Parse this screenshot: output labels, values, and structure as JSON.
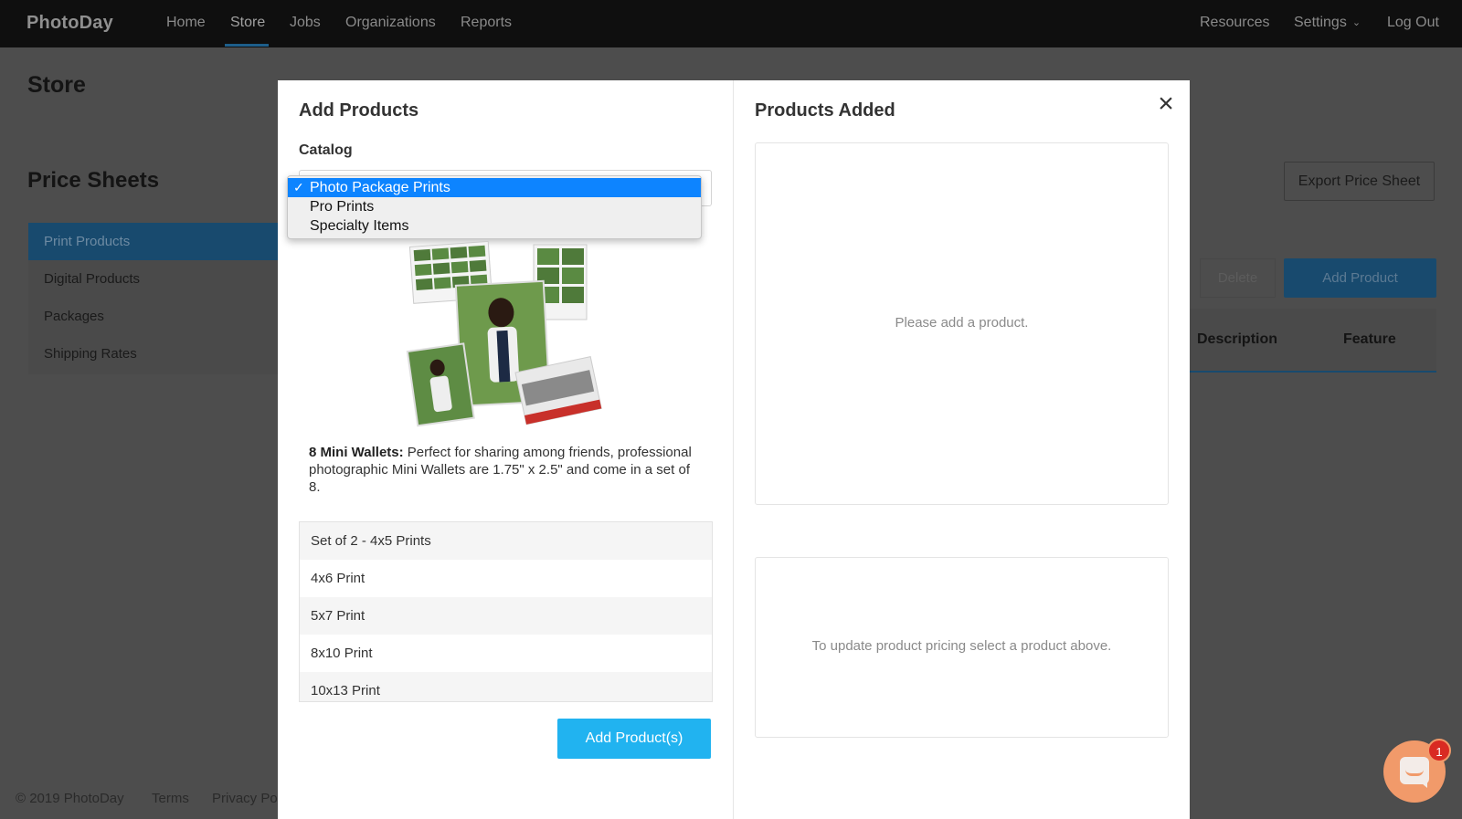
{
  "brand": {
    "logo_text": "PhotoDay"
  },
  "nav": {
    "left": [
      "Home",
      "Store",
      "Jobs",
      "Organizations",
      "Reports"
    ],
    "active": "Store",
    "right": {
      "resources": "Resources",
      "settings": "Settings",
      "logout": "Log Out"
    }
  },
  "page": {
    "title": "Store",
    "section_title": "Price Sheets",
    "sidebar": [
      "Print Products",
      "Digital Products",
      "Packages",
      "Shipping Rates"
    ],
    "export_label": "Export Price Sheet",
    "delete_label": "Delete",
    "add_product_label": "Add Product",
    "table_headers": [
      "Description",
      "Feature"
    ]
  },
  "footer": {
    "copyright": "© 2019 PhotoDay",
    "terms": "Terms",
    "privacy": "Privacy Po"
  },
  "modal": {
    "left_title": "Add Products",
    "catalog_label": "Catalog",
    "catalog_options": [
      "Photo Package Prints",
      "Pro Prints",
      "Specialty Items"
    ],
    "catalog_selected": "Photo Package Prints",
    "product_name": "8 Mini Wallets:",
    "product_description": "Perfect for sharing among friends, professional photographic Mini Wallets are 1.75\" x 2.5\" and come in a set of 8.",
    "products": [
      "Set of 2 - 4x5 Prints",
      "4x6 Print",
      "5x7 Print",
      "8x10 Print",
      "10x13 Print"
    ],
    "add_button": "Add Product(s)",
    "right_title": "Products Added",
    "empty_products_msg": "Please add a product.",
    "pricing_msg": "To update product pricing select a product above."
  },
  "chat": {
    "badge_count": "1"
  },
  "icons": {
    "close": "close-icon",
    "chat": "chat-icon",
    "check": "checkmark-icon",
    "chevron": "chevron-down-icon"
  },
  "colors": {
    "primary": "#21b3f0",
    "nav_bg": "#0f0f0f",
    "select_highlight": "#0d84ff",
    "chat": "#f19a6a",
    "badge": "#d92a22"
  }
}
